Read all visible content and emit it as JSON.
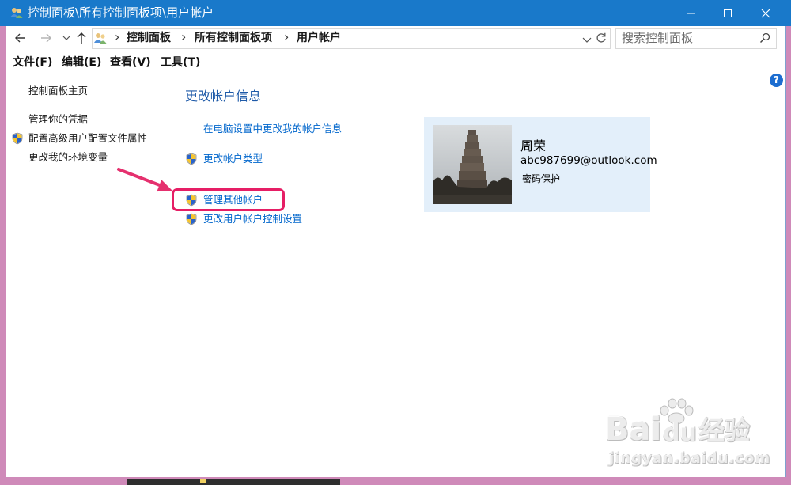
{
  "window": {
    "title": "控制面板\\所有控制面板项\\用户帐户",
    "title_icon": "user-accounts-icon",
    "controls": [
      "minimize-icon",
      "maximize-icon",
      "close-icon"
    ]
  },
  "navigation": {
    "icons": [
      "back-arrow-icon",
      "forward-arrow-icon",
      "recent-chevron-icon",
      "up-arrow-icon"
    ]
  },
  "address_bar": {
    "icon": "user-accounts-icon",
    "separator": "›",
    "breadcrumb": [
      "控制面板",
      "所有控制面板项",
      "用户帐户"
    ],
    "trailing_icons": [
      "dropdown-chevron-icon",
      "refresh-icon"
    ]
  },
  "search": {
    "placeholder": "搜索控制面板",
    "icon": "search-icon"
  },
  "menu": {
    "file": "文件(F)",
    "edit": "编辑(E)",
    "view": "查看(V)",
    "tools": "工具(T)"
  },
  "sidebar": {
    "items": [
      {
        "label": "控制面板主页",
        "shield": false
      },
      {
        "label": "管理你的凭据",
        "shield": false
      },
      {
        "label": "配置高级用户配置文件属性",
        "shield": true
      },
      {
        "label": "更改我的环境变量",
        "shield": false
      }
    ]
  },
  "main": {
    "heading": "更改帐户信息",
    "links": [
      {
        "label": "在电脑设置中更改我的帐户信息",
        "shield": false
      },
      {
        "label": "更改帐户类型",
        "shield": true
      },
      {
        "label": "管理其他帐户",
        "shield": true,
        "highlighted": true
      },
      {
        "label": "更改用户帐户控制设置",
        "shield": true
      }
    ]
  },
  "account": {
    "name": "周荣",
    "email": "abc987699@outlook.com",
    "status": "密码保护",
    "picture": "pagoda-photo"
  },
  "help": {
    "label": "?"
  },
  "annotation": {
    "arrow": "pink-arrow-icon",
    "highlight": "管理其他帐户"
  },
  "watermark": {
    "brand_left": "Bai",
    "brand_right": "du",
    "brand_cn": "经验",
    "url": "jingyan.baidu.com"
  },
  "colors": {
    "title_bar": "#1979CA",
    "link": "#0066CC",
    "heading": "#1E5AA8",
    "highlight": "#E61E65",
    "account_card": "#E3EFFA",
    "help_icon": "#1C6DD0"
  }
}
